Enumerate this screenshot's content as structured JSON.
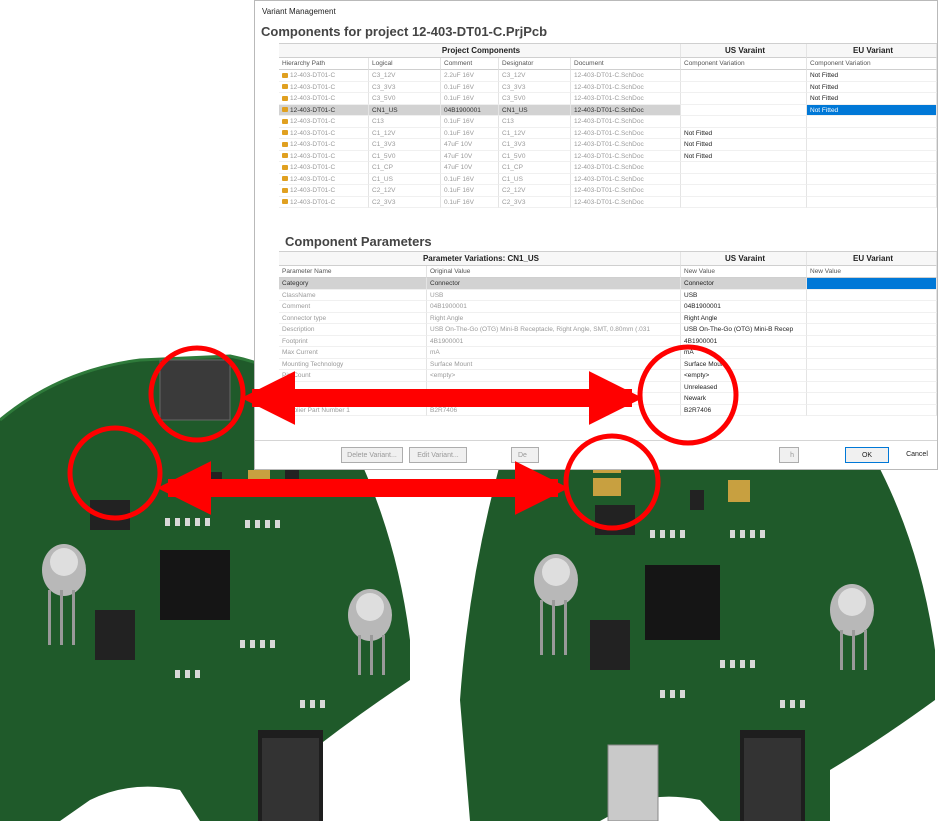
{
  "dialog": {
    "title": "Variant Management",
    "components_title": "Components for project 12-403-DT01-C.PrjPcb",
    "group_headers": {
      "project": "Project Components",
      "us": "US Varaint",
      "eu": "EU Variant"
    },
    "columns": [
      "Hierarchy Path",
      "Logical",
      "Comment",
      "Designator",
      "Document",
      "Component Variation",
      "Component Variation"
    ],
    "rows": [
      [
        "12-403-DT01-C",
        "C3_12V",
        "2.2uF 16V",
        "C3_12V",
        "12-403-DT01-C.SchDoc",
        "",
        "Not Fitted"
      ],
      [
        "12-403-DT01-C",
        "C3_3V3",
        "0.1uF 16V",
        "C3_3V3",
        "12-403-DT01-C.SchDoc",
        "",
        "Not Fitted"
      ],
      [
        "12-403-DT01-C",
        "C3_5V0",
        "0.1uF 16V",
        "C3_5V0",
        "12-403-DT01-C.SchDoc",
        "",
        "Not Fitted"
      ],
      [
        "12-403-DT01-C",
        "CN1_US",
        "04B1900001",
        "CN1_US",
        "12-403-DT01-C.SchDoc",
        "",
        "Not Fitted"
      ],
      [
        "12-403-DT01-C",
        "C13",
        "0.1uF 16V",
        "C13",
        "12-403-DT01-C.SchDoc",
        "",
        ""
      ],
      [
        "12-403-DT01-C",
        "C1_12V",
        "0.1uF 16V",
        "C1_12V",
        "12-403-DT01-C.SchDoc",
        "Not Fitted",
        ""
      ],
      [
        "12-403-DT01-C",
        "C1_3V3",
        "47uF 10V",
        "C1_3V3",
        "12-403-DT01-C.SchDoc",
        "Not Fitted",
        ""
      ],
      [
        "12-403-DT01-C",
        "C1_5V0",
        "47uF 10V",
        "C1_5V0",
        "12-403-DT01-C.SchDoc",
        "Not Fitted",
        ""
      ],
      [
        "12-403-DT01-C",
        "C1_CP",
        "47uF 10V",
        "C1_CP",
        "12-403-DT01-C.SchDoc",
        "",
        ""
      ],
      [
        "12-403-DT01-C",
        "C1_US",
        "0.1uF 16V",
        "C1_US",
        "12-403-DT01-C.SchDoc",
        "",
        ""
      ],
      [
        "12-403-DT01-C",
        "C2_12V",
        "0.1uF 16V",
        "C2_12V",
        "12-403-DT01-C.SchDoc",
        "",
        ""
      ],
      [
        "12-403-DT01-C",
        "C2_3V3",
        "0.1uF 16V",
        "C2_3V3",
        "12-403-DT01-C.SchDoc",
        "",
        ""
      ]
    ],
    "params_title": "Component Parameters",
    "param_group_headers": {
      "variations": "Parameter Variations: CN1_US",
      "us": "US Varaint",
      "eu": "EU Variant"
    },
    "param_columns": [
      "Parameter Name",
      "Original Value",
      "New Value",
      "New Value"
    ],
    "param_rows": [
      [
        "Category",
        "Connector",
        "Connector"
      ],
      [
        "ClassName",
        "USB",
        "USB"
      ],
      [
        "Comment",
        "04B1900001",
        "04B1900001"
      ],
      [
        "Connector type",
        "Right Angle",
        "Right Angle"
      ],
      [
        "Description",
        "USB On-The-Go (OTG) Mini-B Receptacle, Right Angle, SMT, 0.80mm (.031",
        "USB On-The-Go (OTG) Mini-B Recep"
      ],
      [
        "Footprint",
        "4B1900001",
        "4B1900001"
      ],
      [
        "Max Current",
        "mA",
        "mA"
      ],
      [
        "Mounting Technology",
        "Surface Mount",
        "Surface Mount"
      ],
      [
        "Pin Count",
        "<empty>",
        "<empty>"
      ],
      [
        "",
        "",
        "Unreleased"
      ],
      [
        "",
        "",
        "Newark"
      ],
      [
        "Supplier Part Number 1",
        "B2R7406",
        "B2R7406"
      ]
    ],
    "footer": {
      "delete_variant": "Delete Variant...",
      "edit_variant": "Edit Variant...",
      "de_label": "De",
      "h_label": "h",
      "ok": "OK",
      "cancel": "Cancel"
    }
  },
  "colors": {
    "selection_blue": "#0078d7",
    "pcb_green": "#1f5a2a",
    "highlight_red": "#ff0000"
  }
}
